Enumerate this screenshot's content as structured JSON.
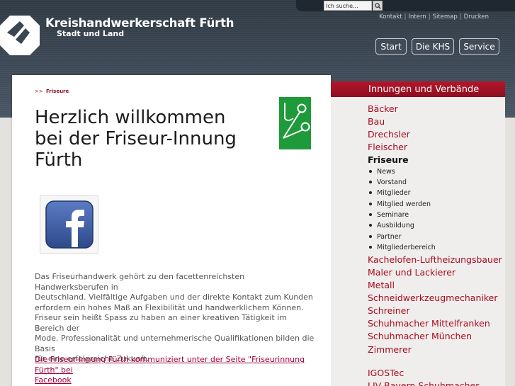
{
  "search": {
    "placeholder": "Ich suche...",
    "value": "Ich suche..."
  },
  "brand": {
    "title": "Kreishandwerkerschaft Fürth",
    "subtitle": "Stadt und Land"
  },
  "utility": {
    "links": [
      "Kontakt",
      "Intern",
      "Sitemap",
      "Drucken"
    ]
  },
  "nav": {
    "start": "Start",
    "khs": "Die KHS",
    "service": "Service"
  },
  "breadcrumb": {
    "arrows": ">>",
    "current": "Friseure"
  },
  "main": {
    "title_lines": [
      "Herzlich willkommen",
      "bei der Friseur-Innung",
      "Fürth"
    ],
    "paragraph1_lines": [
      "Das Friseurhandwerk gehört zu den facettenreichsten Handwerksberufen in",
      "Deutschland. Vielfältige Aufgaben und der direkte Kontakt zum Kunden",
      "erfordern ein hohes Maß an Flexibilität und handwerklichem Können."
    ],
    "paragraph2_lines": [
      "Friseur sein heißt Spass zu haben an einer kreativen Tätigkeit im Bereich der",
      "Mode. Professionalität und unternehmerische Qualifikationen bilden die Basis",
      "für eine erfolgreiche Zukunft."
    ],
    "link_lines": [
      "Die Friseur-Innung Fürth kommuniziert unter der Seite \"Friseurinnung Fürth\" bei",
      "Facebook"
    ]
  },
  "sidebar": {
    "heading": "Innungen und Verbände",
    "items_top": [
      "Bäcker",
      "Bau",
      "Drechsler",
      "Fleischer"
    ],
    "active": "Friseure",
    "subitems": [
      "News",
      "Vorstand",
      "Mitglieder",
      "Mitglied werden",
      "Seminare",
      "Ausbildung",
      "Partner",
      "Mitgliederbereich"
    ],
    "items_bottom": [
      "Kachelofen-Luftheizungsbauer",
      "Maler und Lackierer",
      "Metall",
      "Schneidwerkzeugmechaniker",
      "Schreiner",
      "Schuhmacher Mittelfranken",
      "Schuhmacher München",
      "Zimmerer"
    ],
    "items_extra": [
      "IGOSTec",
      "LIV Bayern Schuhmacher"
    ]
  },
  "colors": {
    "accent": "#a80a1f",
    "header": "#3a4652",
    "facebook": "#3b5998",
    "guild_green": "#1f9a3a"
  },
  "icons": {
    "search": "magnifier-icon",
    "facebook": "facebook-icon",
    "logo": "khs-logo",
    "guild": "scissors-logo"
  }
}
